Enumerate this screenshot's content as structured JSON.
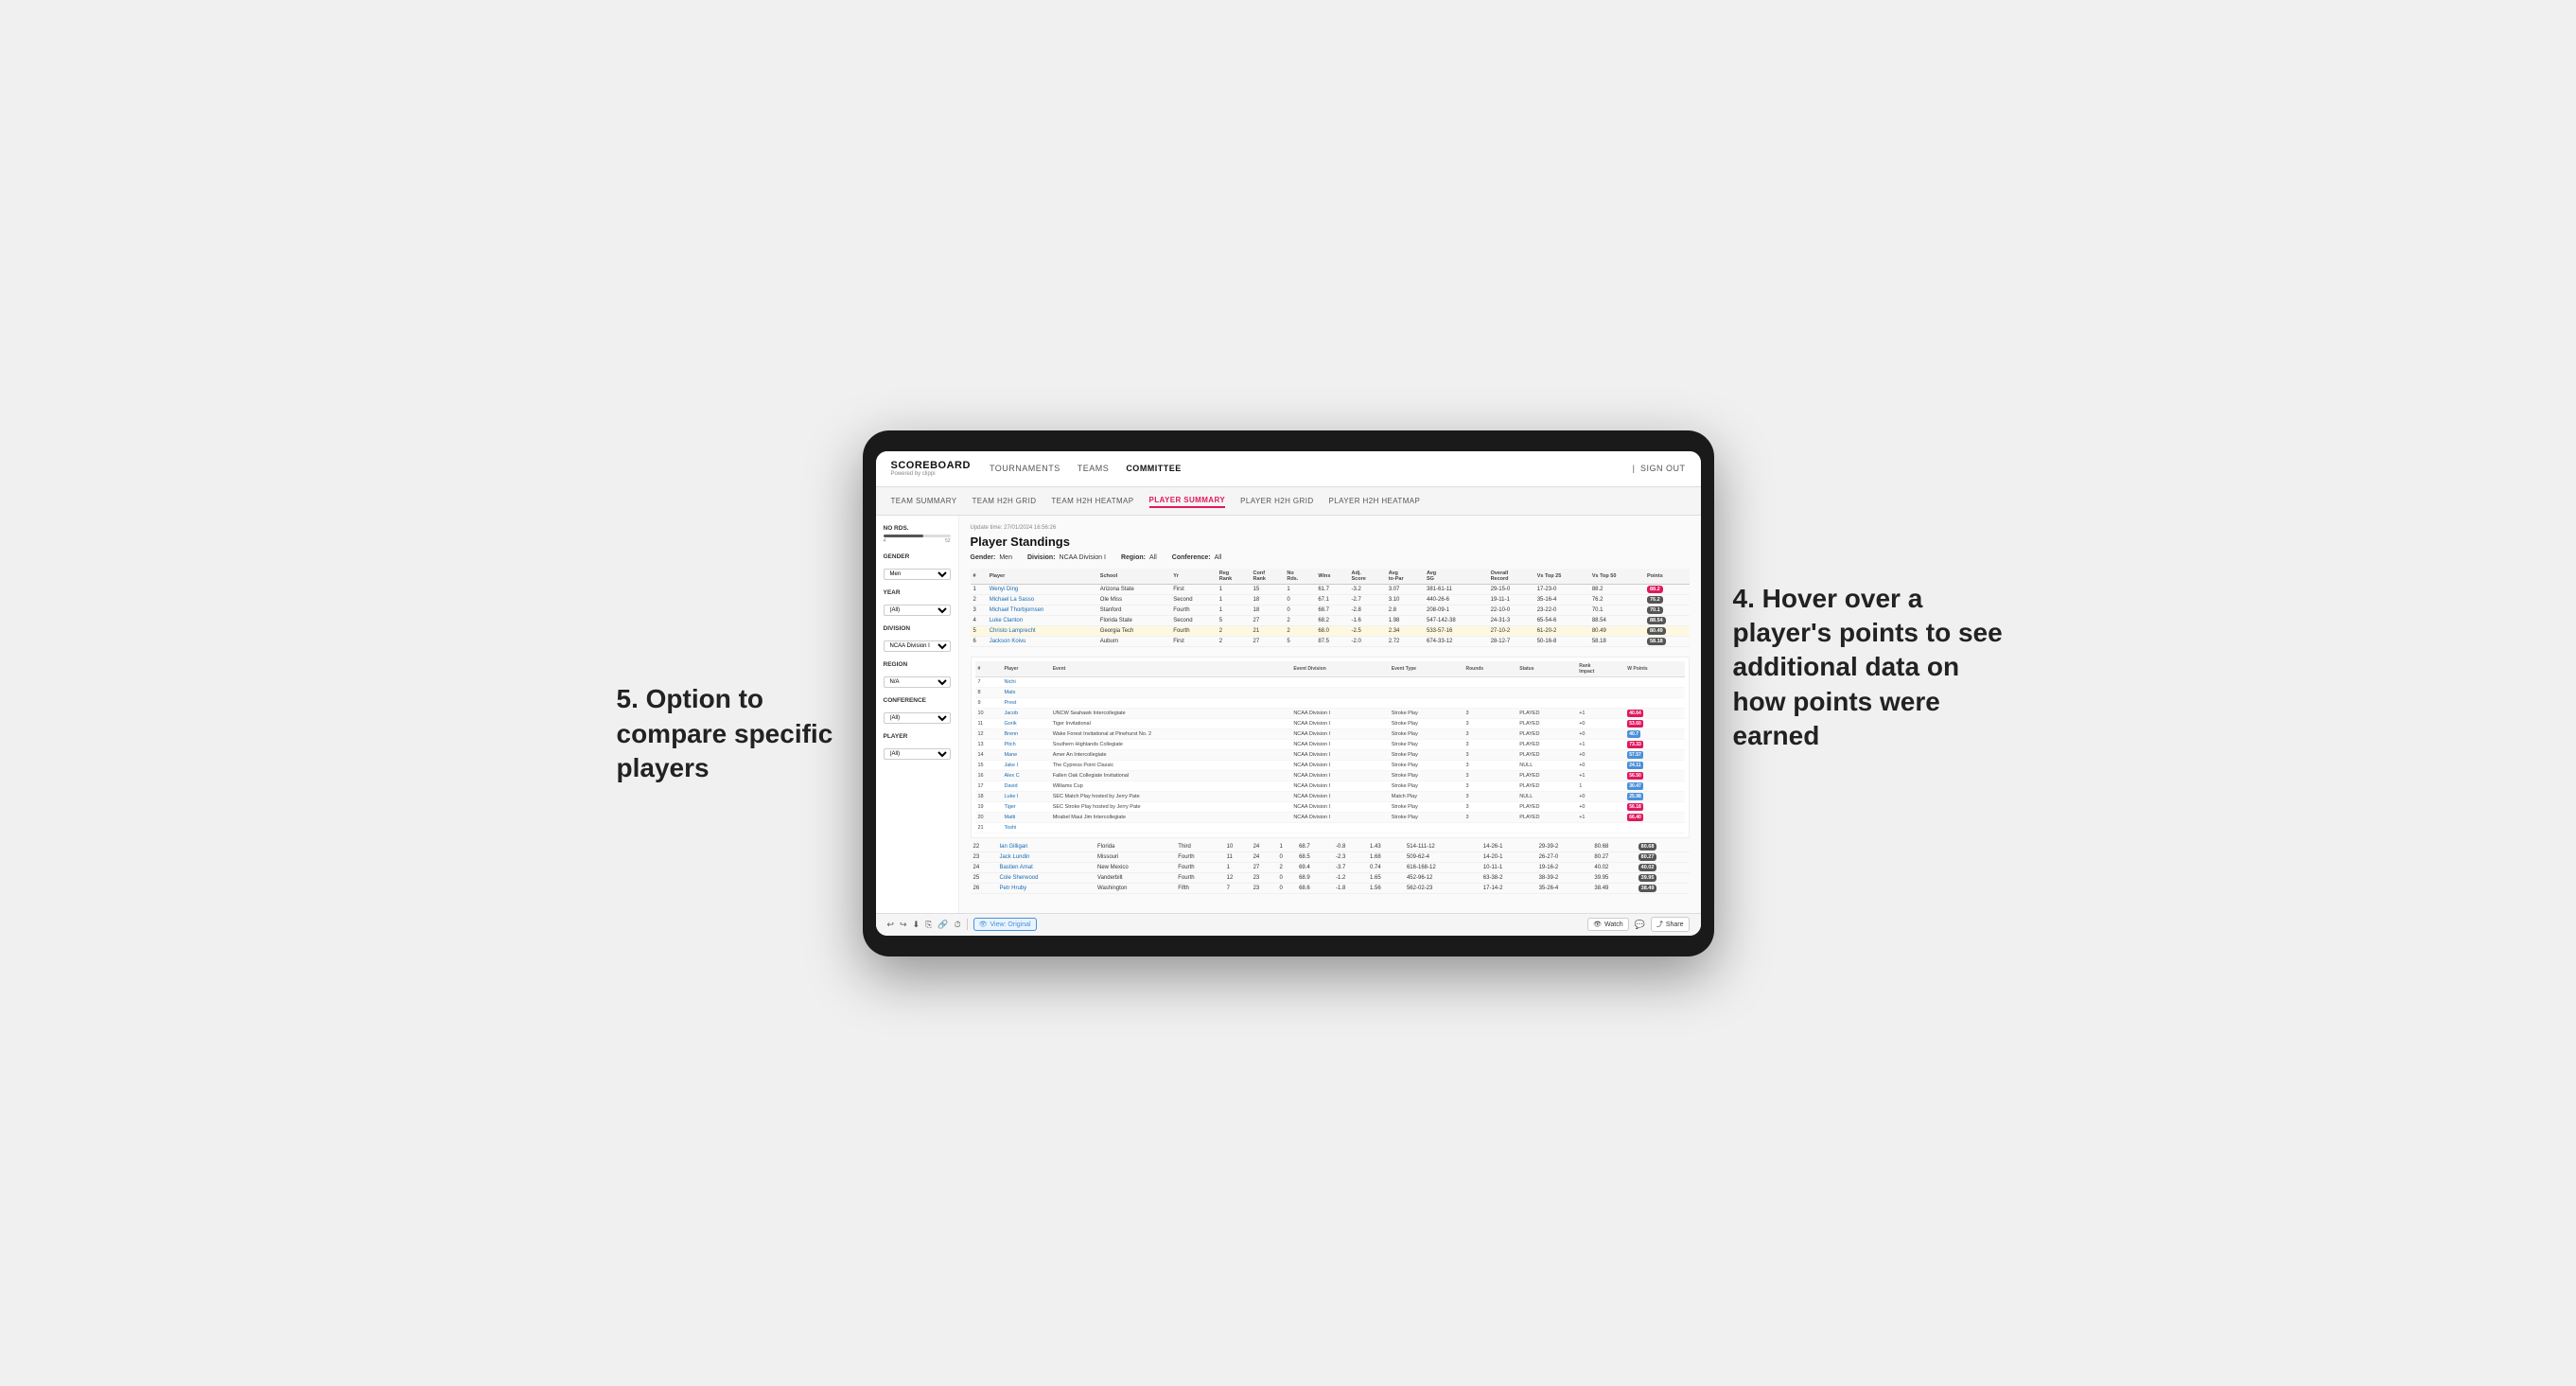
{
  "brand": {
    "title": "SCOREBOARD",
    "subtitle": "Powered by clippi"
  },
  "top_nav": {
    "links": [
      "TOURNAMENTS",
      "TEAMS",
      "COMMITTEE"
    ],
    "active": "COMMITTEE",
    "right": [
      "Sign out"
    ]
  },
  "secondary_nav": {
    "links": [
      "TEAM SUMMARY",
      "TEAM H2H GRID",
      "TEAM H2H HEATMAP",
      "PLAYER SUMMARY",
      "PLAYER H2H GRID",
      "PLAYER H2H HEATMAP"
    ],
    "active": "PLAYER SUMMARY"
  },
  "update_time": "Update time: 27/01/2024 16:56:26",
  "section_title": "Player Standings",
  "filters": {
    "gender_label": "Gender:",
    "gender_value": "Men",
    "division_label": "Division:",
    "division_value": "NCAA Division I",
    "region_label": "Region:",
    "region_value": "All",
    "conference_label": "Conference:",
    "conference_value": "All"
  },
  "sidebar": {
    "no_rds_label": "No Rds.",
    "no_rds_min": "4",
    "no_rds_max": "52",
    "gender_label": "Gender",
    "gender_value": "Men",
    "year_label": "Year",
    "year_value": "(All)",
    "division_label": "Division",
    "division_value": "NCAA Division I",
    "region_label": "Region",
    "region_value": "N/A",
    "conference_label": "Conference",
    "conference_value": "(All)",
    "player_label": "Player",
    "player_value": "(All)"
  },
  "standings_headers": [
    "#",
    "Player",
    "School",
    "Yr",
    "Reg Rank",
    "Conf Rank",
    "No Rds.",
    "Wins",
    "Adj. Score",
    "Avg to-Par",
    "Avg SG",
    "Overall Record",
    "Vs Top 25",
    "Vs Top 50",
    "Points"
  ],
  "standings_rows": [
    {
      "num": "1",
      "player": "Wenyi Ding",
      "school": "Arizona State",
      "yr": "First",
      "reg_rank": "1",
      "conf_rank": "15",
      "no_rds": "1",
      "wins": "61.7",
      "adj_score": "-3.2",
      "avg_topar": "3.07",
      "avg_sg": "381-61-11",
      "overall": "29-15-0",
      "vs25": "17-23-0",
      "vs50": "88.2",
      "points_badge": true,
      "points": "88.2"
    },
    {
      "num": "2",
      "player": "Michael La Sasso",
      "school": "Ole Miss",
      "yr": "Second",
      "reg_rank": "1",
      "conf_rank": "18",
      "no_rds": "0",
      "wins": "67.1",
      "adj_score": "-2.7",
      "avg_topar": "3.10",
      "avg_sg": "440-26-6",
      "overall": "19-11-1",
      "vs25": "35-16-4",
      "vs50": "76.2",
      "points_badge": false,
      "points": "76.2"
    },
    {
      "num": "3",
      "player": "Michael Thorbjornsen",
      "school": "Stanford",
      "yr": "Fourth",
      "reg_rank": "1",
      "conf_rank": "18",
      "no_rds": "0",
      "wins": "68.7",
      "adj_score": "-2.8",
      "avg_topar": "2.8",
      "avg_sg": "208-09-1",
      "overall": "22-10-0",
      "vs25": "23-22-0",
      "vs50": "70.1",
      "points_badge": false,
      "points": "70.1"
    },
    {
      "num": "4",
      "player": "Luke Clanton",
      "school": "Florida State",
      "yr": "Second",
      "reg_rank": "5",
      "conf_rank": "27",
      "no_rds": "2",
      "wins": "68.2",
      "adj_score": "-1.6",
      "avg_topar": "1.98",
      "avg_sg": "547-142-38",
      "overall": "24-31-3",
      "vs25": "65-54-6",
      "vs50": "88.54",
      "points_badge": false,
      "points": "88.54"
    },
    {
      "num": "5",
      "player": "Christo Lamprecht",
      "school": "Georgia Tech",
      "yr": "Fourth",
      "reg_rank": "2",
      "conf_rank": "21",
      "no_rds": "2",
      "wins": "68.0",
      "adj_score": "-2.5",
      "avg_topar": "2.34",
      "avg_sg": "533-57-16",
      "overall": "27-10-2",
      "vs25": "61-20-2",
      "vs50": "80.49",
      "points_badge": false,
      "points": "80.49",
      "highlighted": true
    },
    {
      "num": "6",
      "player": "Jackson Koivu",
      "school": "Auburn",
      "yr": "First",
      "reg_rank": "2",
      "conf_rank": "27",
      "no_rds": "5",
      "wins": "87.5",
      "adj_score": "-2.0",
      "avg_topar": "2.72",
      "avg_sg": "674-33-12",
      "overall": "28-12-7",
      "vs25": "50-16-8",
      "vs50": "58.18",
      "points_badge": false,
      "points": "58.18"
    }
  ],
  "detail_player": "Jackson Koivu",
  "detail_headers": [
    "Player",
    "Event",
    "Event Division",
    "Event Type",
    "Rounds",
    "Status",
    "Rank Impact",
    "W Points"
  ],
  "detail_rows": [
    {
      "num": "7",
      "player": "Nichi",
      "event": "",
      "division": "",
      "type": "",
      "rounds": "",
      "status": "",
      "rank": "",
      "wpoints": ""
    },
    {
      "num": "8",
      "player": "Mats",
      "event": "",
      "division": "",
      "type": "",
      "rounds": "",
      "status": "",
      "rank": "",
      "wpoints": ""
    },
    {
      "num": "9",
      "player": "Prest",
      "event": "",
      "division": "",
      "type": "",
      "rounds": "",
      "status": "",
      "rank": "",
      "wpoints": ""
    },
    {
      "num": "10",
      "player": "Jacob",
      "event": "UNCW Seahawk Intercollegiate",
      "division": "NCAA Division I",
      "type": "Stroke Play",
      "rounds": "3",
      "status": "PLAYED",
      "rank": "+1",
      "wpoints": "40.64",
      "badge_color": "red"
    },
    {
      "num": "11",
      "player": "Gorik",
      "event": "Tiger Invitational",
      "division": "NCAA Division I",
      "type": "Stroke Play",
      "rounds": "3",
      "status": "PLAYED",
      "rank": "+0",
      "wpoints": "53.60",
      "badge_color": "red"
    },
    {
      "num": "12",
      "player": "Brenn",
      "event": "Wake Forest Invitational at Pinehurst No. 2",
      "division": "NCAA Division I",
      "type": "Stroke Play",
      "rounds": "3",
      "status": "PLAYED",
      "rank": "+0",
      "wpoints": "40.7",
      "badge_color": "blue"
    },
    {
      "num": "13",
      "player": "Pitch",
      "event": "Southern Highlands Collegiate",
      "division": "NCAA Division I",
      "type": "Stroke Play",
      "rounds": "3",
      "status": "PLAYED",
      "rank": "+1",
      "wpoints": "73.33",
      "badge_color": "red"
    },
    {
      "num": "14",
      "player": "Mane",
      "event": "Amer An Intercollegiate",
      "division": "NCAA Division I",
      "type": "Stroke Play",
      "rounds": "3",
      "status": "PLAYED",
      "rank": "+0",
      "wpoints": "57.57",
      "badge_color": "blue"
    },
    {
      "num": "15",
      "player": "Jake I",
      "event": "The Cypress Point Classic",
      "division": "NCAA Division I",
      "type": "Stroke Play",
      "rounds": "3",
      "status": "NULL",
      "rank": "+0",
      "wpoints": "24.11",
      "badge_color": "blue"
    },
    {
      "num": "16",
      "player": "Alex C",
      "event": "Fallen Oak Collegiate Invitational",
      "division": "NCAA Division I",
      "type": "Stroke Play",
      "rounds": "3",
      "status": "PLAYED",
      "rank": "+1",
      "wpoints": "56.50",
      "badge_color": "red"
    },
    {
      "num": "17",
      "player": "David",
      "event": "Williams Cup",
      "division": "NCAA Division I",
      "type": "Stroke Play",
      "rounds": "3",
      "status": "PLAYED",
      "rank": "1",
      "wpoints": "30.47",
      "badge_color": "blue"
    },
    {
      "num": "18",
      "player": "Luke I",
      "event": "SEC Match Play hosted by Jerry Pate",
      "division": "NCAA Division I",
      "type": "Match Play",
      "rounds": "3",
      "status": "NULL",
      "rank": "+0",
      "wpoints": "25.98",
      "badge_color": "blue"
    },
    {
      "num": "19",
      "player": "Tiger",
      "event": "SEC Stroke Play hosted by Jerry Pate",
      "division": "NCAA Division I",
      "type": "Stroke Play",
      "rounds": "3",
      "status": "PLAYED",
      "rank": "+0",
      "wpoints": "56.18",
      "badge_color": "red"
    },
    {
      "num": "20",
      "player": "Matti",
      "event": "Mirabel Maui Jim Intercollegiate",
      "division": "NCAA Division I",
      "type": "Stroke Play",
      "rounds": "3",
      "status": "PLAYED",
      "rank": "+1",
      "wpoints": "66.40",
      "badge_color": "red"
    },
    {
      "num": "21",
      "player": "Toshi",
      "event": "",
      "division": "",
      "type": "",
      "rounds": "",
      "status": "",
      "rank": "",
      "wpoints": ""
    }
  ],
  "lower_standings": [
    {
      "num": "22",
      "player": "Ian Gilligan",
      "school": "Florida",
      "yr": "Third",
      "reg_rank": "10",
      "conf_rank": "24",
      "no_rds": "1",
      "wins": "68.7",
      "adj_score": "-0.8",
      "avg_topar": "1.43",
      "avg_sg": "514-111-12",
      "overall": "14-26-1",
      "vs25": "29-39-2",
      "vs50": "80.68",
      "points": "80.68"
    },
    {
      "num": "23",
      "player": "Jack Lundin",
      "school": "Missouri",
      "yr": "Fourth",
      "reg_rank": "11",
      "conf_rank": "24",
      "no_rds": "0",
      "wins": "68.5",
      "adj_score": "-2.3",
      "avg_topar": "1.68",
      "avg_sg": "509-62-4",
      "overall": "14-20-1",
      "vs25": "26-27-0",
      "vs50": "80.27",
      "points": "80.27"
    },
    {
      "num": "24",
      "player": "Bastien Amat",
      "school": "New Mexico",
      "yr": "Fourth",
      "reg_rank": "1",
      "conf_rank": "27",
      "no_rds": "2",
      "wins": "69.4",
      "adj_score": "-3.7",
      "avg_topar": "0.74",
      "avg_sg": "616-168-12",
      "overall": "10-11-1",
      "vs25": "19-16-2",
      "vs50": "40.02",
      "points": "40.02"
    },
    {
      "num": "25",
      "player": "Cole Sherwood",
      "school": "Vanderbilt",
      "yr": "Fourth",
      "reg_rank": "12",
      "conf_rank": "23",
      "no_rds": "0",
      "wins": "68.9",
      "adj_score": "-1.2",
      "avg_topar": "1.65",
      "avg_sg": "452-96-12",
      "overall": "63-38-2",
      "vs25": "38-39-2",
      "vs50": "39.95",
      "points": "39.95"
    },
    {
      "num": "26",
      "player": "Petr Hruby",
      "school": "Washington",
      "yr": "Fifth",
      "reg_rank": "7",
      "conf_rank": "23",
      "no_rds": "0",
      "wins": "68.6",
      "adj_score": "-1.8",
      "avg_topar": "1.56",
      "avg_sg": "562-02-23",
      "overall": "17-14-2",
      "vs25": "35-26-4",
      "vs50": "38.49",
      "points": "38.49"
    }
  ],
  "toolbar": {
    "view_label": "View: Original",
    "watch_label": "Watch",
    "share_label": "Share"
  },
  "annotations": {
    "right_text": "4. Hover over a player's points to see additional data on how points were earned",
    "left_text": "5. Option to compare specific players"
  }
}
